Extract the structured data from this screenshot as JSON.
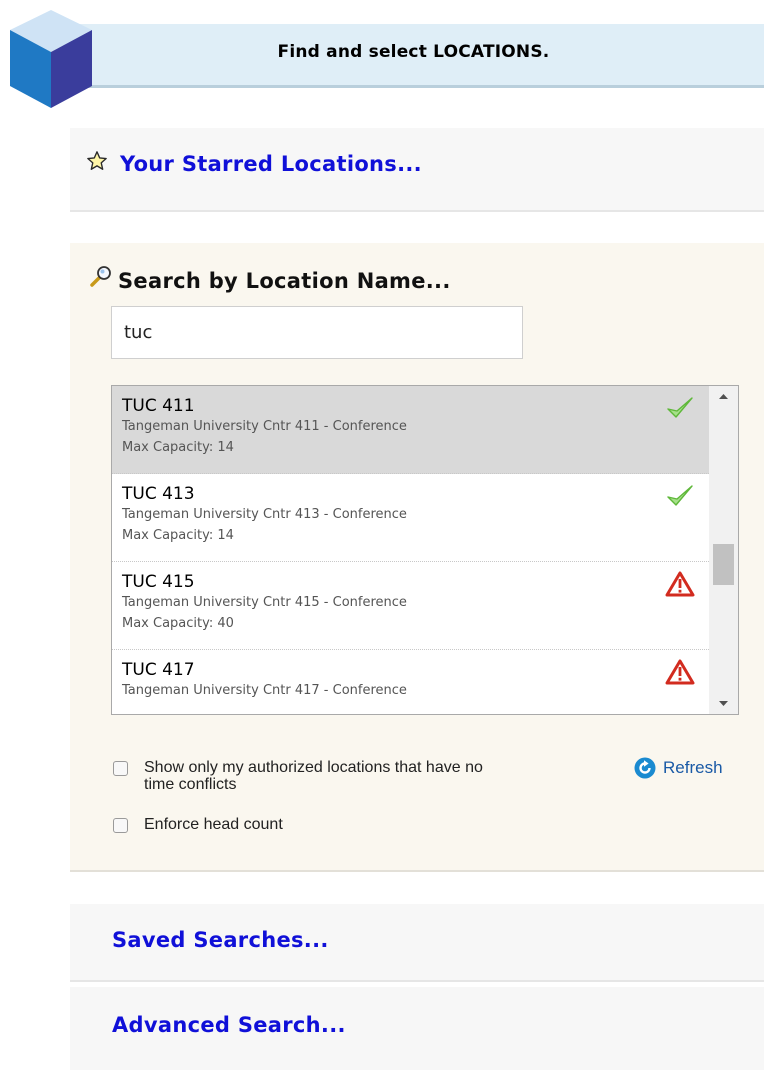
{
  "header": {
    "title": "Find and select LOCATIONS."
  },
  "starred": {
    "heading": "Your Starred Locations..."
  },
  "search": {
    "heading": "Search by Location Name...",
    "input_value": "tuc",
    "results": [
      {
        "code": "TUC 411",
        "description": "Tangeman University Cntr 411 - Conference",
        "capacity": "Max Capacity: 14",
        "status": "available",
        "selected": true
      },
      {
        "code": "TUC 413",
        "description": "Tangeman University Cntr 413 - Conference",
        "capacity": "Max Capacity: 14",
        "status": "available",
        "selected": false
      },
      {
        "code": "TUC 415",
        "description": "Tangeman University Cntr 415 - Conference",
        "capacity": "Max Capacity: 40",
        "status": "conflict",
        "selected": false
      },
      {
        "code": "TUC 417",
        "description": "Tangeman University Cntr 417 - Conference",
        "capacity": "",
        "status": "conflict",
        "selected": false
      }
    ],
    "options": {
      "authorized_label": "Show only my authorized locations that have no time conflicts",
      "authorized_checked": false,
      "headcount_label": "Enforce head count",
      "headcount_checked": false
    },
    "refresh_label": "Refresh"
  },
  "saved": {
    "heading": "Saved Searches..."
  },
  "advanced": {
    "heading": "Advanced Search..."
  },
  "icons": {
    "logo": "cube-logo-icon",
    "starred": "star-icon",
    "search": "magnifier-icon",
    "available": "checkmark-icon",
    "conflict": "warning-triangle-icon",
    "refresh": "refresh-icon"
  },
  "colors": {
    "header_background": "#dfeef7",
    "link_blue": "#1010d8",
    "search_panel_background": "#faf7ef",
    "selected_row": "#d9d9d9",
    "check_green": "#6ccb3c",
    "warning_red": "#d22b1f",
    "refresh_blue": "#1a8ad0"
  }
}
